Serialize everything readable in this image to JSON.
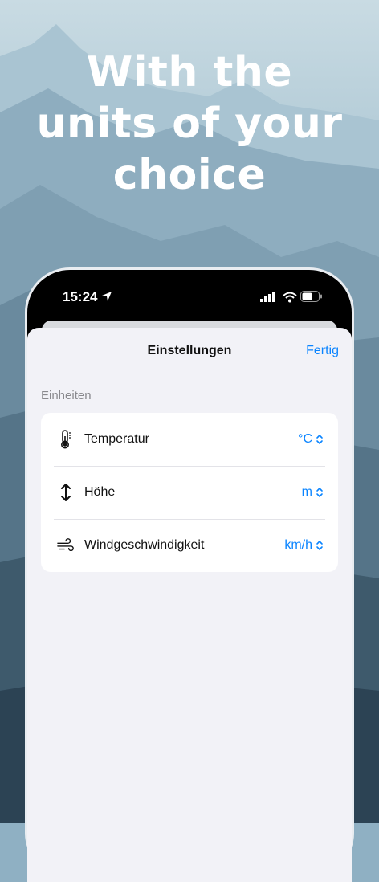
{
  "headline": {
    "line1": "With the",
    "line2": "units of your",
    "line3": "choice"
  },
  "status_bar": {
    "time": "15:24"
  },
  "nav": {
    "title": "Einstellungen",
    "done_label": "Fertig"
  },
  "units_section": {
    "header": "Einheiten",
    "rows": [
      {
        "label": "Temperatur",
        "value": "°C",
        "icon": "thermometer-icon"
      },
      {
        "label": "Höhe",
        "value": "m",
        "icon": "up-down-arrow-icon"
      },
      {
        "label": "Windgeschwindigkeit",
        "value": "km/h",
        "icon": "wind-icon"
      }
    ]
  },
  "colors": {
    "accent": "#0a84ff",
    "sheet_background": "#f2f2f7",
    "card_background": "#ffffff"
  }
}
